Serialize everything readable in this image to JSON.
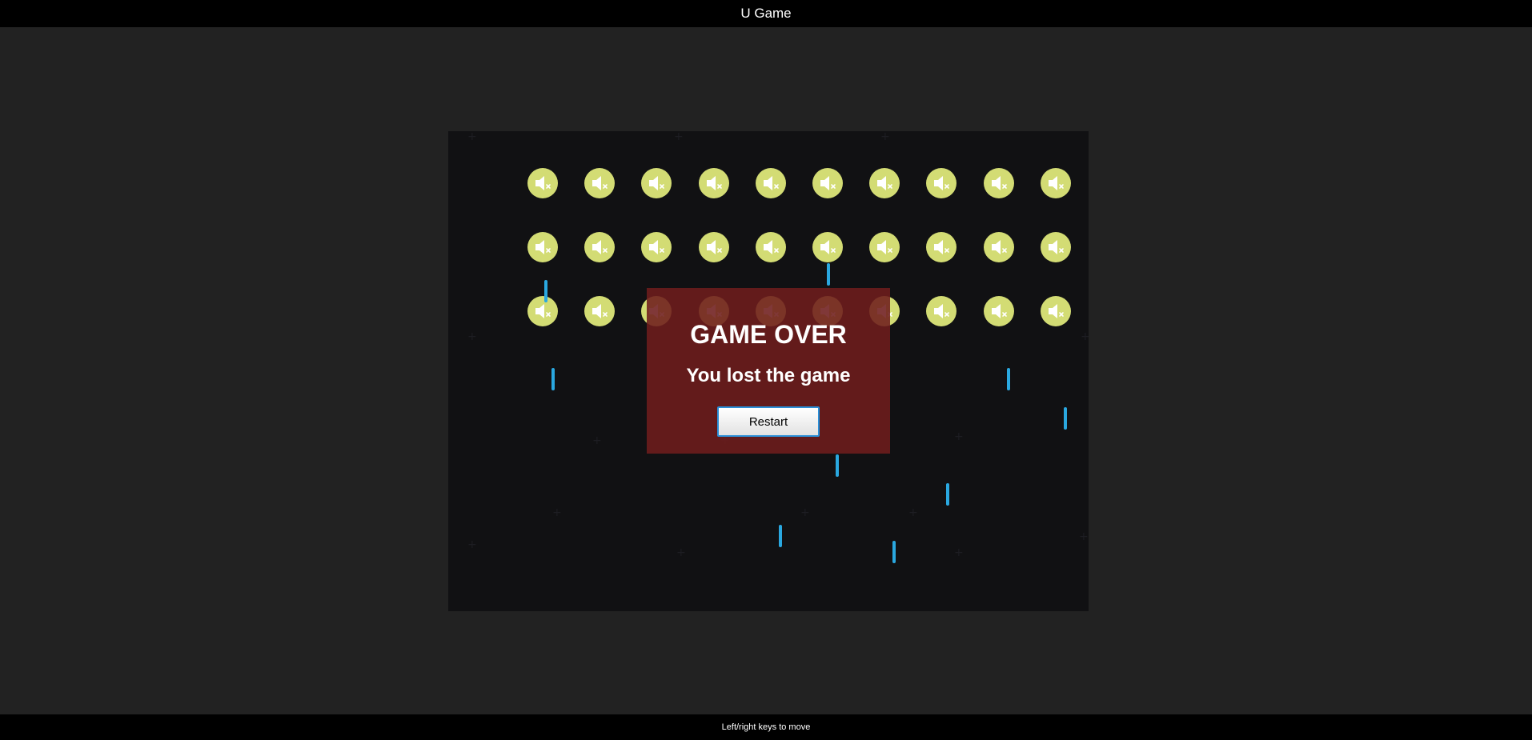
{
  "header": {
    "title": "U Game"
  },
  "footer": {
    "hint": "Left/right keys to move"
  },
  "game": {
    "state": "game-over",
    "colors": {
      "background": "#222222",
      "board": "#111113",
      "invader": "#d3dc74",
      "bullet": "#2aa8e0",
      "overlay": "#6e1c1c"
    },
    "invader_icon": "speaker-muted-icon",
    "invader_rows": 3,
    "invader_cols": 10
  },
  "overlay": {
    "title": "GAME OVER",
    "message": "You lost the game",
    "restart_label": "Restart"
  }
}
